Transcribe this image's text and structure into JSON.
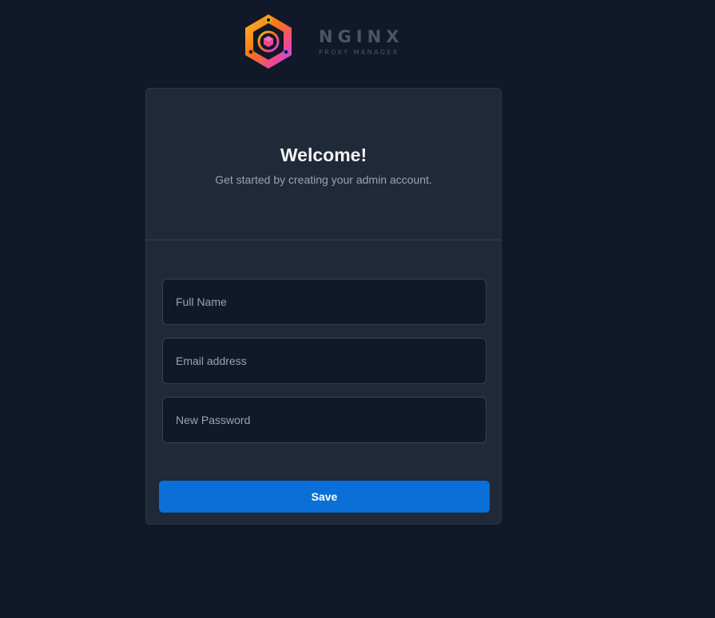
{
  "brand": {
    "name": "NGINX",
    "subtitle": "PROXY MANAGER",
    "logo_icon": "hexagon-cube-logo-icon"
  },
  "card": {
    "title": "Welcome!",
    "subtitle": "Get started by creating your admin account."
  },
  "form": {
    "full_name": {
      "placeholder": "Full Name",
      "value": ""
    },
    "email": {
      "placeholder": "Email address",
      "value": ""
    },
    "password": {
      "placeholder": "New Password",
      "value": ""
    },
    "save_label": "Save"
  },
  "colors": {
    "background": "#111827",
    "card": "#1f2937",
    "accent": "#0a6fd6"
  }
}
